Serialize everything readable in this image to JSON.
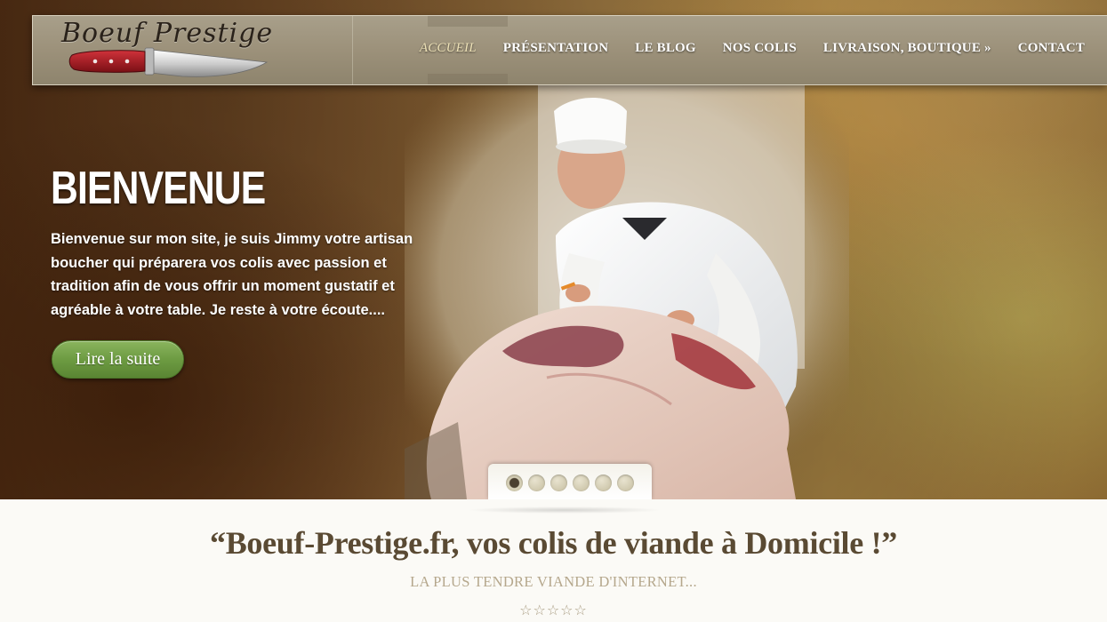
{
  "brand": {
    "logo_text": "Boeuf Prestige"
  },
  "nav": {
    "items": [
      {
        "label": "ACCUEIL",
        "active": true
      },
      {
        "label": "PRÉSENTATION",
        "active": false
      },
      {
        "label": "LE BLOG",
        "active": false
      },
      {
        "label": "NOS COLIS",
        "active": false
      },
      {
        "label": "LIVRAISON, BOUTIQUE »",
        "active": false
      },
      {
        "label": "CONTACT",
        "active": false
      }
    ]
  },
  "hero": {
    "title": "BIENVENUE",
    "body": "Bienvenue sur mon site, je suis Jimmy votre artisan boucher qui préparera vos colis avec passion et tradition afin de vous offrir un moment gustatif et agréable à votre table. Je reste à votre écoute....",
    "cta_label": "Lire la suite"
  },
  "slider": {
    "slide_count": 6,
    "active_index": 0
  },
  "tagline": {
    "headline": "“Boeuf-Prestige.fr, vos colis de viande à Domicile !”",
    "subheadline": "LA PLUS TENDRE VIANDE D'INTERNET...",
    "rating_display": "☆☆☆☆☆",
    "rating_value": 0,
    "rating_max": 5
  },
  "colors": {
    "accent_green": "#6d9b42",
    "header_bar": "#9c917a",
    "tagline_text": "#5a4a33",
    "subtagline_text": "#b5a78c",
    "nav_active": "#efe3b8"
  },
  "icons": {
    "logo": "chef-knife-logo-icon",
    "rating": "star-outline-icon"
  }
}
